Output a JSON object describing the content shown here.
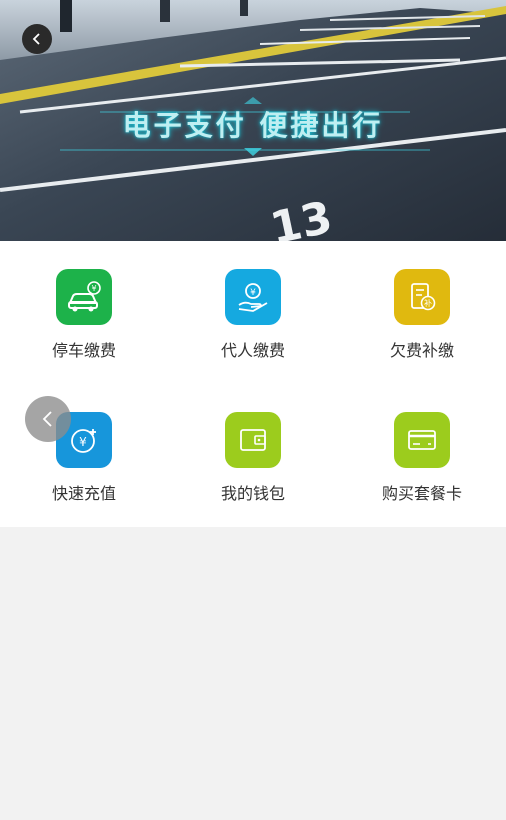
{
  "banner": {
    "slogan": "电子支付  便捷出行",
    "parking_number": "13"
  },
  "services": [
    {
      "label": "停车缴费",
      "icon": "parking-payment-icon",
      "color": "#1db24a"
    },
    {
      "label": "代人缴费",
      "icon": "proxy-payment-icon",
      "color": "#15a9e0"
    },
    {
      "label": "欠费补缴",
      "icon": "arrears-payment-icon",
      "color": "#e0b90f"
    },
    {
      "label": "快速充值",
      "icon": "quick-recharge-icon",
      "color": "#1796db"
    },
    {
      "label": "我的钱包",
      "icon": "wallet-icon",
      "color": "#9ccc1d"
    },
    {
      "label": "购买套餐卡",
      "icon": "package-card-icon",
      "color": "#9ccc1d"
    }
  ]
}
